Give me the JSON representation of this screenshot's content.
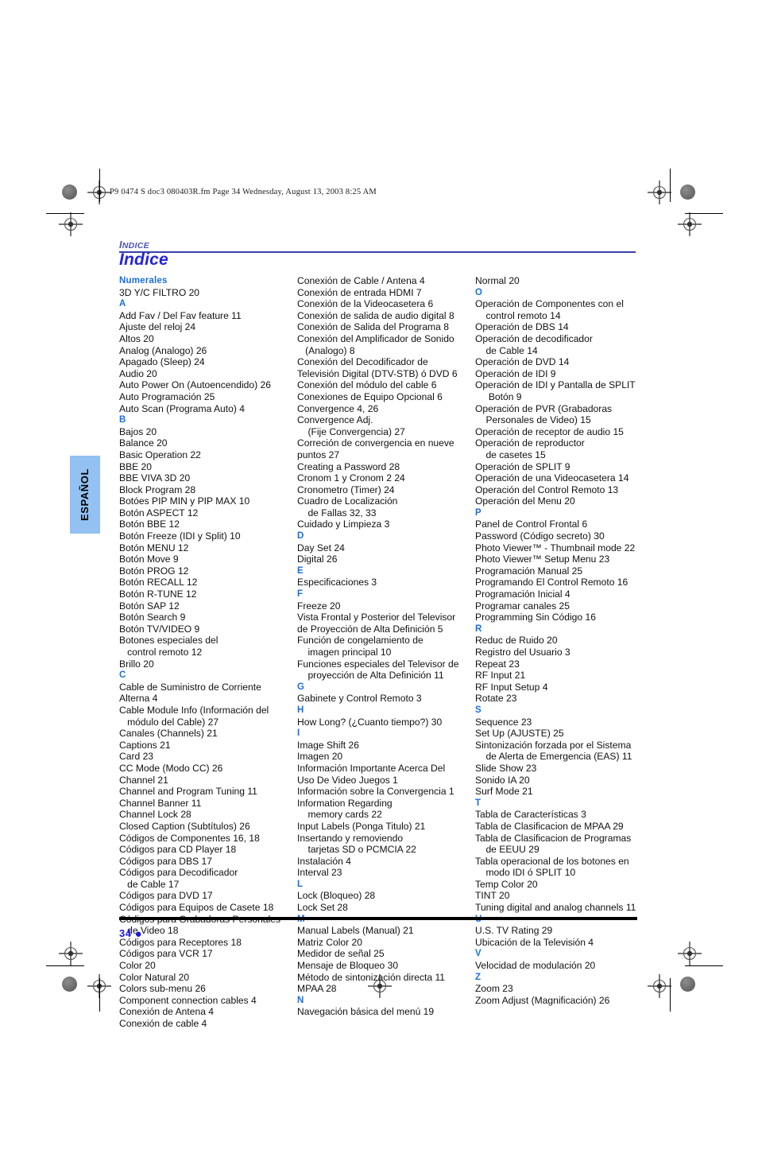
{
  "header": {
    "file_stamp": "P9 0474 S doc3  080403R.fm  Page 34  Wednesday, August 13, 2003  8:25 AM"
  },
  "title_block": {
    "kicker_first": "I",
    "kicker_rest": "NDICE",
    "page_title": "Indice"
  },
  "side_tab": {
    "label": "ESPAÑOL"
  },
  "footer": {
    "page_number": "34",
    "bullet": "●"
  },
  "index": {
    "columns": [
      {
        "blocks": [
          {
            "letter": "Numerales",
            "entries": [
              "3D Y/C FILTRO 20"
            ]
          },
          {
            "letter": "A",
            "entries": [
              "Add Fav / Del Fav feature 11",
              "Ajuste del reloj 24",
              "Altos 20",
              "Analog (Analogo) 26",
              "Apagado (Sleep) 24",
              "Audio 20",
              "Auto Power On (Autoencendido) 26",
              "Auto Programación 25",
              "Auto Scan (Programa Auto) 4"
            ]
          },
          {
            "letter": "B",
            "entries": [
              "Bajos 20",
              "Balance 20",
              "Basic Operation 22",
              "BBE 20",
              "BBE VIVA 3D 20",
              "Block Program 28",
              "Botóes PIP MIN y PIP MAX 10",
              "Botón ASPECT 12",
              "Botón BBE 12",
              "Botón Freeze (IDI y Split) 10",
              "Botón MENU 12",
              "Botón Move 9",
              "Botón PROG 12",
              "Botón RECALL 12",
              "Botón R-TUNE 12",
              "Botón SAP 12",
              "Botón Search 9",
              "Botón TV/VIDEO 9",
              "Botones especiales del\n   control remoto 12",
              "Brillo 20"
            ]
          },
          {
            "letter": "C",
            "entries": [
              "Cable de Suministro de Corriente\nAlterna 4",
              "Cable Module Info (Información del\n   módulo del Cable) 27",
              "Canales (Channels) 21",
              "Captions 21",
              "Card 23",
              "CC Mode (Modo CC) 26",
              "Channel 21",
              "Channel and Program Tuning 11",
              "Channel Banner 11",
              "Channel Lock 28",
              "Closed Caption (Subtítulos) 26",
              "Códigos de Componentes 16, 18",
              "Códigos para CD Player 18",
              "Códigos para DBS 17",
              "Códigos para Decodificador\n   de Cable 17",
              "Códigos para DVD 17",
              "Códigos para Equipos de Casete 18",
              "Códigos para Grabadoras Personales\n   de Video 18",
              "Códigos para Receptores 18",
              "Códigos para VCR 17",
              "Color 20",
              "Color Natural 20",
              "Colors sub-menu 26",
              "Component connection cables 4",
              "Conexión de Antena 4",
              "Conexión de cable 4"
            ]
          }
        ]
      },
      {
        "blocks": [
          {
            "letter": "",
            "entries": [
              "Conexión de Cable / Antena 4",
              "Conexión de entrada HDMI 7",
              "Conexión de la Videocasetera 6",
              "Conexión de salida de audio digital 8",
              "Conexión de Salida del Programa 8",
              "Conexión del Amplificador de Sonido\n   (Analogo) 8",
              "Conexión del Decodificador de\nTelevisión Digital (DTV-STB) ó DVD 6",
              "Conexión del módulo del cable 6",
              "Conexiones de Equipo Opcional 6",
              "Convergence 4, 26",
              "Convergence Adj.\n    (Fije Convergencia) 27",
              "Correción de convergencia en nueve\npuntos 27",
              "Creating a Password 28",
              "Cronom 1 y Cronom 2 24",
              "Cronometro (Timer) 24",
              "Cuadro de Localización\n    de Fallas 32, 33",
              "Cuidado y Limpieza 3"
            ]
          },
          {
            "letter": "D",
            "entries": [
              "Day Set 24",
              "Digital 26"
            ]
          },
          {
            "letter": "E",
            "entries": [
              "Especificaciones 3"
            ]
          },
          {
            "letter": "F",
            "entries": [
              "Freeze 20",
              "Vista Frontal y Posterior del Televisor\nde Proyección de Alta Definición 5",
              "Función de congelamiento de\n    imagen principal 10",
              "Funciones especiales del Televisor de\n    proyección de Alta Definición 11"
            ]
          },
          {
            "letter": "G",
            "entries": [
              "Gabinete y Control Remoto 3"
            ]
          },
          {
            "letter": "H",
            "entries": [
              "How Long? (¿Cuanto tiempo?) 30"
            ]
          },
          {
            "letter": "I",
            "entries": [
              "Image Shift 26",
              "Imagen 20",
              "Información Importante Acerca Del\nUso De Video Juegos 1",
              "Información sobre la Convergencia 1",
              "Information Regarding\n    memory cards 22",
              "Input Labels (Ponga Titulo) 21",
              "Insertando y removiendo\n    tarjetas SD o PCMCIA 22",
              "Instalación 4",
              "Interval 23"
            ]
          },
          {
            "letter": "L",
            "entries": [
              "Lock (Bloqueo) 28",
              "Lock Set 28"
            ]
          },
          {
            "letter": "M",
            "entries": [
              "Manual Labels (Manual) 21",
              "Matriz Color 20",
              "Medidor de señal 25",
              "Mensaje de Bloqueo 30",
              "Método de sintonización directa 11",
              "MPAA 28"
            ]
          },
          {
            "letter": "N",
            "entries": [
              "Navegación básica del menú 19"
            ]
          }
        ]
      },
      {
        "blocks": [
          {
            "letter": "",
            "entries": [
              "Normal 20"
            ]
          },
          {
            "letter": "O",
            "entries": [
              "Operación de Componentes con el\n    control remoto 14",
              "Operación de DBS 14",
              "Operación de decodificador\n    de Cable 14",
              "Operación de DVD 14",
              "Operación de IDI 9",
              "Operación de IDI y Pantalla de SPLIT\n     Botón 9",
              "Operación de PVR (Grabadoras\n    Personales de Video) 15",
              "Operación de receptor de audio 15",
              "Operación de reproductor\n    de casetes 15",
              "Operación de SPLIT 9",
              "Operación de una Videocasetera 14",
              "Operación del Control Remoto 13",
              "Operación del Menu 20"
            ]
          },
          {
            "letter": "P",
            "entries": [
              "Panel de Control Frontal 6",
              "Password (Código secreto) 30",
              "Photo Viewer™ - Thumbnail mode 22",
              "Photo Viewer™ Setup Menu 23",
              "Programación Manual 25",
              "Programando El Control Remoto 16",
              "Programación Inicial 4",
              "Programar canales 25",
              "Programming Sin Código 16"
            ]
          },
          {
            "letter": "R",
            "entries": [
              "Reduc de Ruido 20",
              "Registro del Usuario 3",
              "Repeat 23",
              "RF Input 21",
              "RF Input Setup 4",
              "Rotate 23"
            ]
          },
          {
            "letter": "S",
            "entries": [
              "Sequence 23",
              "Set Up (AJUSTE) 25",
              "Sintonización forzada por el Sistema\n    de Alerta de Emergencia (EAS) 11",
              "Slide Show 23",
              "Sonido IA 20",
              "Surf Mode 21"
            ]
          },
          {
            "letter": "T",
            "entries": [
              "Tabla de Características 3",
              "Tabla de Clasificacion de MPAA 29",
              "Tabla de Clasificacion de Programas\n    de EEUU 29",
              "Tabla operacional de los botones en\n    modo IDI ó SPLIT 10",
              "Temp Color 20",
              "TINT 20",
              "Tuning digital and analog channels 11"
            ]
          },
          {
            "letter": "U",
            "entries": [
              "U.S. TV Rating 29",
              "Ubicación de la Televisión 4"
            ]
          },
          {
            "letter": "V",
            "entries": [
              "Velocidad de modulación 20"
            ]
          },
          {
            "letter": "Z",
            "entries": [
              "Zoom 23",
              "Zoom Adjust (Magnificación) 26"
            ]
          }
        ]
      }
    ]
  }
}
